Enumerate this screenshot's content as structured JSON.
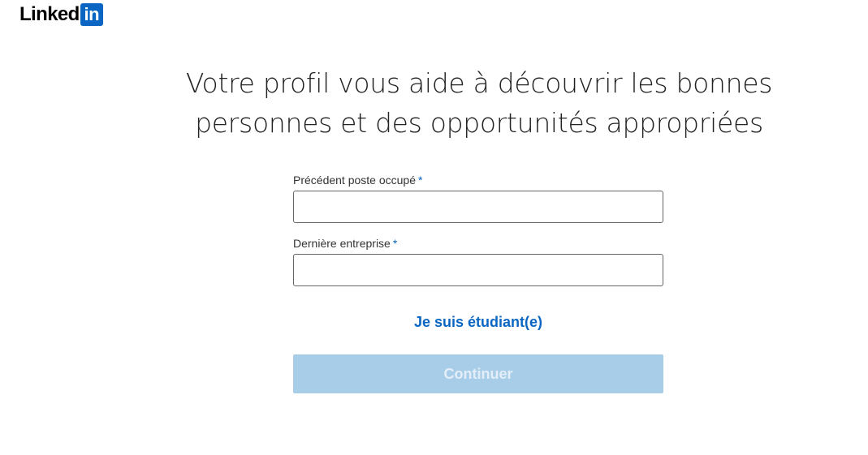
{
  "brand": {
    "logo_text": "Linked",
    "logo_box_text": "in",
    "accent_color": "#0a66c2"
  },
  "main": {
    "headline_line1": "Votre profil vous aide à découvrir les bonnes",
    "headline_line2": "personnes et des opportunités appropriées"
  },
  "form": {
    "job_title": {
      "label": "Précédent poste occupé",
      "required_marker": "*",
      "value": ""
    },
    "company": {
      "label": "Dernière entreprise",
      "required_marker": "*",
      "value": ""
    },
    "student_link": "Je suis étudiant(e)",
    "continue_label": "Continuer",
    "continue_disabled_color": "#a8cde8"
  }
}
